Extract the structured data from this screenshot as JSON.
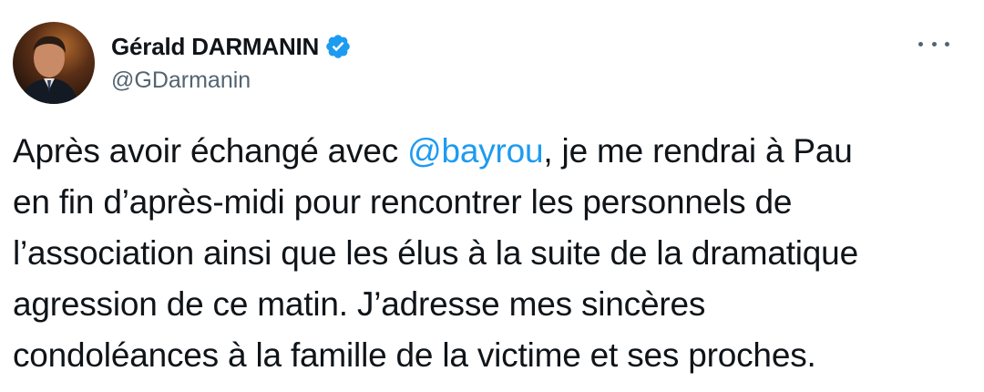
{
  "author": {
    "display_name": "Gérald DARMANIN",
    "handle": "@GDarmanin",
    "verified": true,
    "avatar_icon": "profile-photo"
  },
  "menu": {
    "icon": "more-horizontal-icon"
  },
  "tweet": {
    "line1_pre": "Après avoir échangé avec ",
    "line1_mention": "@bayrou",
    "line1_post": ", je me rendrai à Pau",
    "line2": "en fin d’après-midi pour rencontrer les personnels de",
    "line3": "l’association ainsi que les élus à la suite de la dramatique",
    "line4": "agression de ce matin. J’adresse mes sincères",
    "line5": "condoléances à la famille de la victime et ses proches."
  },
  "colors": {
    "accent": "#1d9bf0",
    "text": "#0f1419",
    "secondary": "#536471"
  }
}
